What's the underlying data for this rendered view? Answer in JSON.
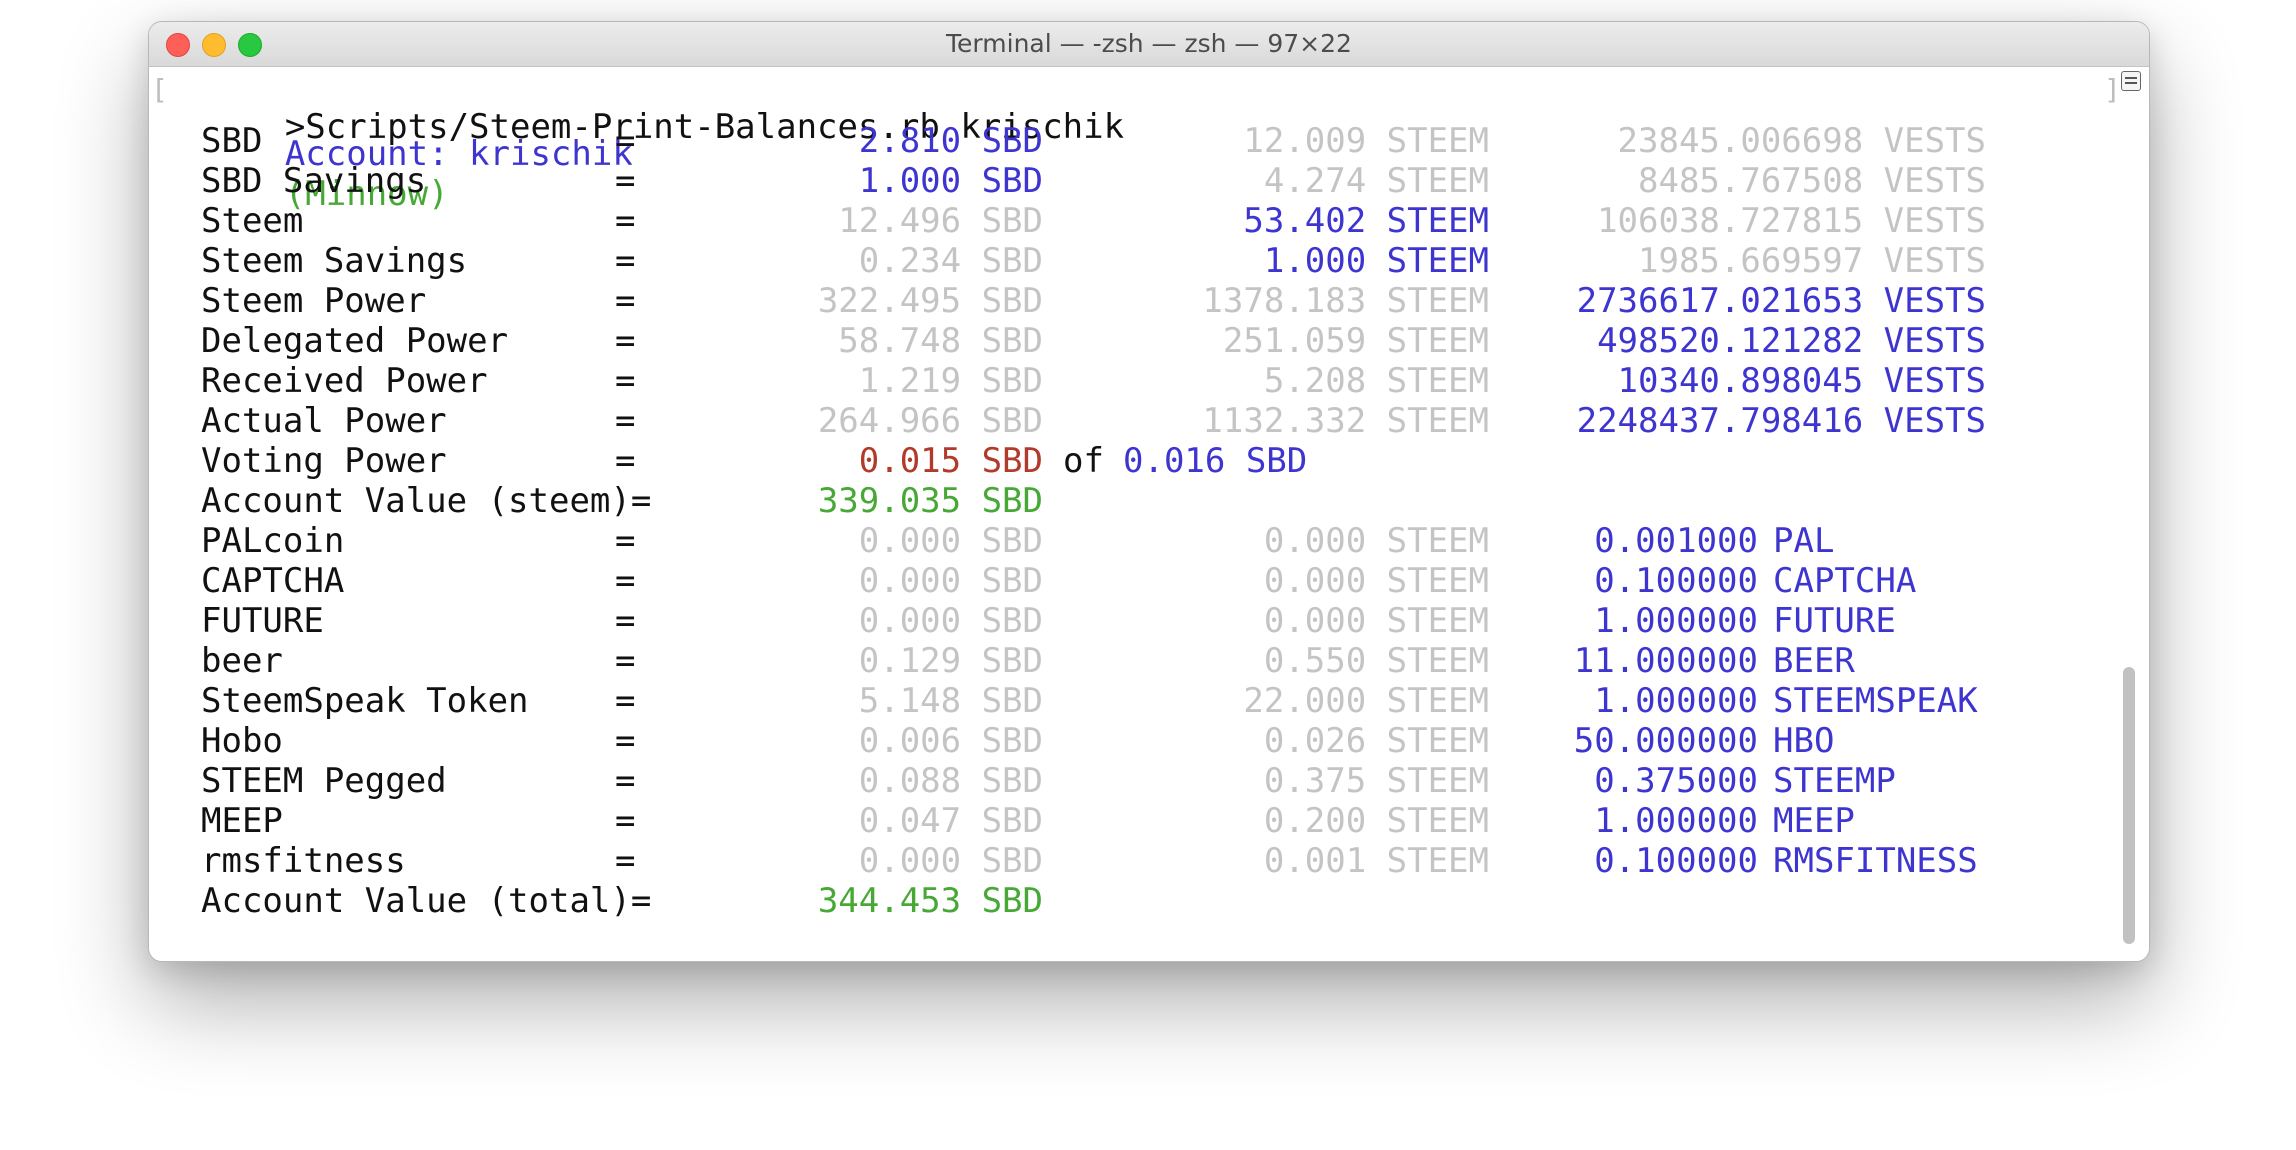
{
  "window": {
    "title": "Terminal — -zsh — zsh — 97×22"
  },
  "command": ">Scripts/Steem-Print-Balances.rb krischik",
  "account": {
    "prefix": "Account: krischik",
    "rank": "(Minnow)"
  },
  "rows": [
    {
      "label": "SBD",
      "eq": "=",
      "sbd": "2.810 SBD",
      "steem": "12.009 STEEM",
      "vests": "23845.006698 VESTS",
      "hl": "sbd"
    },
    {
      "label": "SBD Savings",
      "eq": "=",
      "sbd": "1.000 SBD",
      "steem": "4.274 STEEM",
      "vests": "8485.767508 VESTS",
      "hl": "sbd"
    },
    {
      "label": "Steem",
      "eq": "=",
      "sbd": "12.496 SBD",
      "steem": "53.402 STEEM",
      "vests": "106038.727815 VESTS",
      "hl": "steem"
    },
    {
      "label": "Steem Savings",
      "eq": "=",
      "sbd": "0.234 SBD",
      "steem": "1.000 STEEM",
      "vests": "1985.669597 VESTS",
      "hl": "steem"
    },
    {
      "label": "Steem Power",
      "eq": "=",
      "sbd": "322.495 SBD",
      "steem": "1378.183 STEEM",
      "vests": "2736617.021653 VESTS",
      "hl": "vests"
    },
    {
      "label": "Delegated Power",
      "eq": "=",
      "sbd": "58.748 SBD",
      "steem": "251.059 STEEM",
      "vests": "498520.121282 VESTS",
      "hl": "vests"
    },
    {
      "label": "Received Power",
      "eq": "=",
      "sbd": "1.219 SBD",
      "steem": "5.208 STEEM",
      "vests": "10340.898045 VESTS",
      "hl": "vests"
    },
    {
      "label": "Actual Power",
      "eq": "=",
      "sbd": "264.966 SBD",
      "steem": "1132.332 STEEM",
      "vests": "2248437.798416 VESTS",
      "hl": "vests"
    }
  ],
  "voting": {
    "label": "Voting Power",
    "eq": "=",
    "value": "0.015 SBD",
    "of": "of",
    "max": "0.016 SBD"
  },
  "account_value_steem": {
    "label": "Account Value (steem)=",
    "value": "339.035 SBD"
  },
  "tokens": [
    {
      "label": "PALcoin",
      "eq": "=",
      "sbd": "0.000 SBD",
      "steem": "0.000 STEEM",
      "amount": "0.001000 PAL"
    },
    {
      "label": "CAPTCHA",
      "eq": "=",
      "sbd": "0.000 SBD",
      "steem": "0.000 STEEM",
      "amount": "0.100000 CAPTCHA"
    },
    {
      "label": "FUTURE",
      "eq": "=",
      "sbd": "0.000 SBD",
      "steem": "0.000 STEEM",
      "amount": "1.000000 FUTURE"
    },
    {
      "label": "beer",
      "eq": "=",
      "sbd": "0.129 SBD",
      "steem": "0.550 STEEM",
      "amount": "11.000000 BEER"
    },
    {
      "label": "SteemSpeak Token",
      "eq": "=",
      "sbd": "5.148 SBD",
      "steem": "22.000 STEEM",
      "amount": "1.000000 STEEMSPEAK"
    },
    {
      "label": "Hobo",
      "eq": "=",
      "sbd": "0.006 SBD",
      "steem": "0.026 STEEM",
      "amount": "50.000000 HBO"
    },
    {
      "label": "STEEM Pegged",
      "eq": "=",
      "sbd": "0.088 SBD",
      "steem": "0.375 STEEM",
      "amount": "0.375000 STEEMP"
    },
    {
      "label": "MEEP",
      "eq": "=",
      "sbd": "0.047 SBD",
      "steem": "0.200 STEEM",
      "amount": "1.000000 MEEP"
    },
    {
      "label": "rmsfitness",
      "eq": "=",
      "sbd": "0.000 SBD",
      "steem": "0.001 STEEM",
      "amount": "0.100000 RMSFITNESS"
    }
  ],
  "account_value_total": {
    "label": "Account Value (total)=",
    "value": "344.453 SBD"
  },
  "colors": {
    "highlight": "#3e35d0",
    "dim": "#c4c4c4",
    "positive": "#47a836",
    "warning": "#b23a2b",
    "text": "#111111"
  }
}
